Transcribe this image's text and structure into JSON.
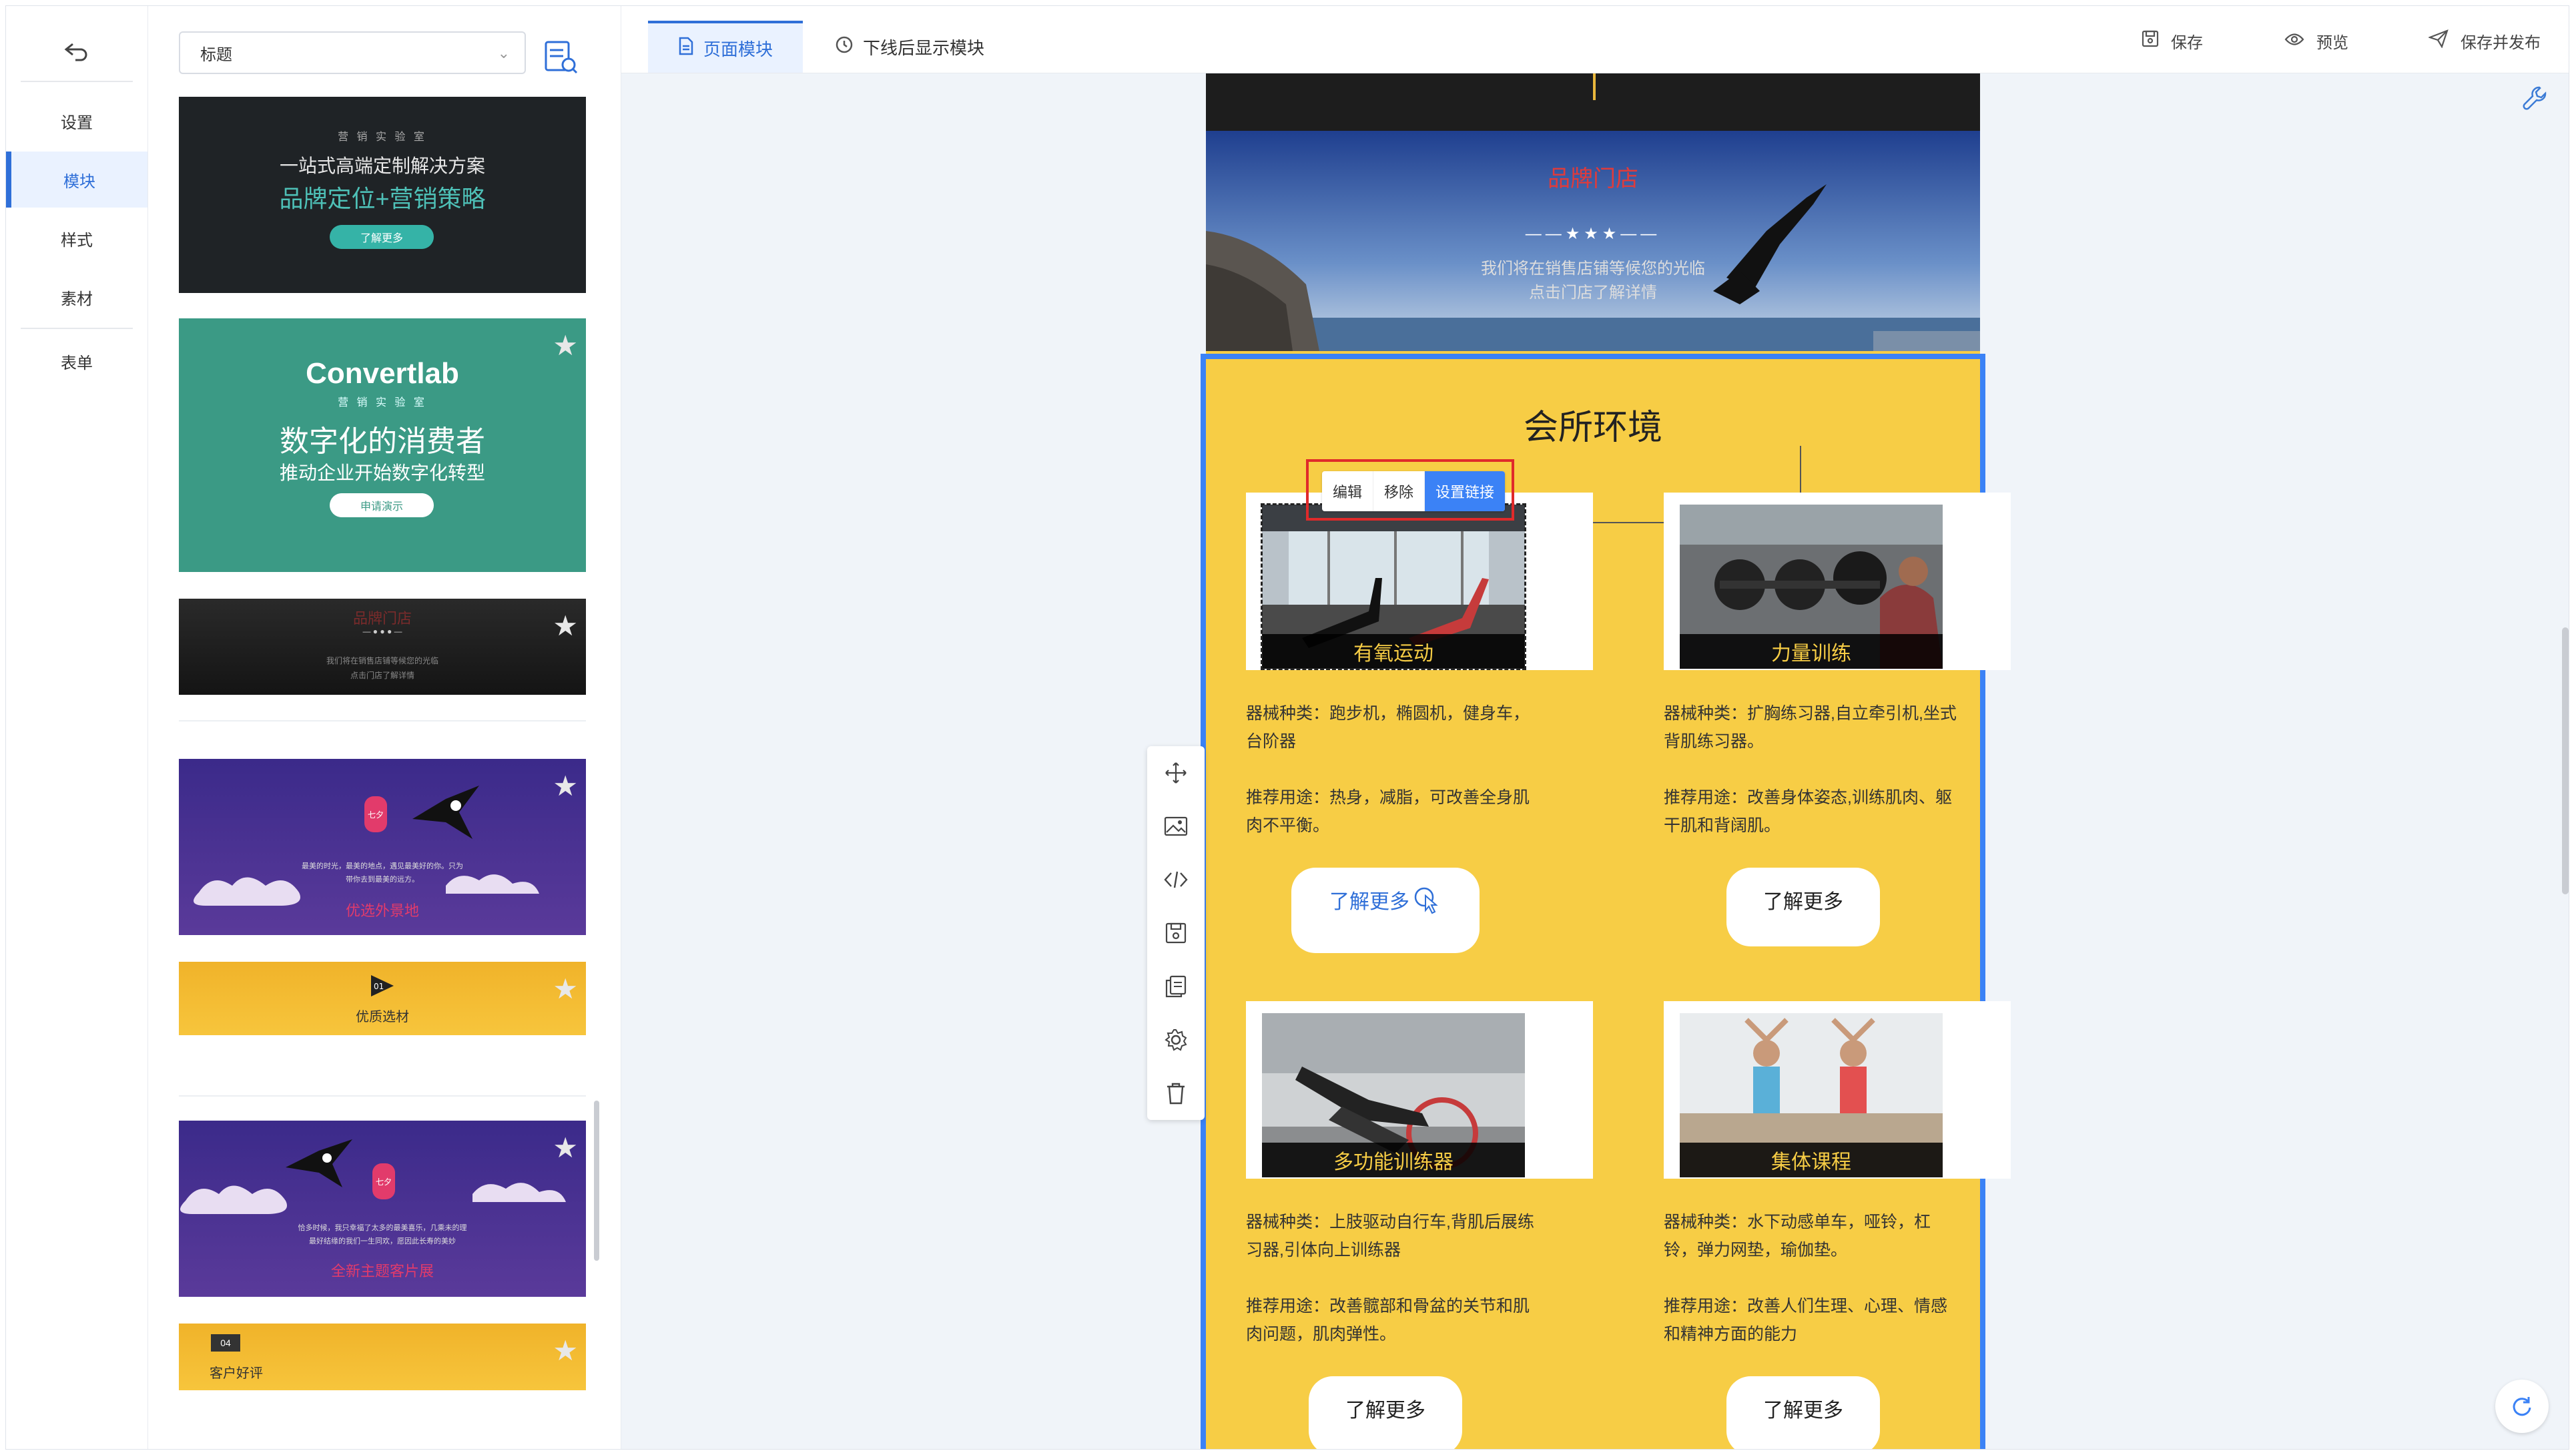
{
  "nav": {
    "back_icon": "back-arrow-icon",
    "items": [
      {
        "label": "设置",
        "active": false
      },
      {
        "label": "模块",
        "active": true
      },
      {
        "label": "样式",
        "active": false
      },
      {
        "label": "素材",
        "active": false
      },
      {
        "label": "表单",
        "active": false
      }
    ]
  },
  "panel": {
    "select_value": "标题",
    "thumbs": [
      {
        "line1": "营 销 实 验 室",
        "line2": "一站式高端定制解决方案",
        "line3": "品牌定位+营销策略",
        "button": "了解更多"
      },
      {
        "brand": "Convertlab",
        "line1": "营 销 实 验 室",
        "line2": "数字化的消费者",
        "line3": "推动企业开始数字化转型",
        "button": "申请演示"
      },
      {
        "title": "品牌门店",
        "sub1": "我们将在销售店铺等候您的光临",
        "sub2": "点击门店了解详情"
      },
      {
        "badge": "七夕",
        "text1": "最美的时光，最美的地点，遇见最美好的你。只为",
        "text2": "带你去到最美的远方。",
        "title": "优选外景地"
      },
      {
        "badge": "01",
        "title": "优质选材"
      },
      {
        "badge": "七夕",
        "text1": "恰多时候，我只幸福了太多的最美喜乐，几乘未的理",
        "text2": "最好结缘的我们一生同欢，愿因此长寿的美妙",
        "title": "全新主题客片展"
      },
      {
        "badge": "04",
        "title": "客户好评"
      }
    ]
  },
  "header": {
    "tabs": [
      {
        "label": "页面模块",
        "active": true
      },
      {
        "label": "下线后显示模块",
        "active": false
      }
    ],
    "actions": [
      {
        "label": "保存",
        "icon": "save-icon"
      },
      {
        "label": "预览",
        "icon": "eye-icon"
      },
      {
        "label": "保存并发布",
        "icon": "send-icon"
      }
    ]
  },
  "page": {
    "banner": {
      "title": "品牌门店",
      "stars": "——★★★——",
      "sub1": "我们将在销售店铺等候您的光临",
      "sub2": "点击门店了解详情"
    },
    "section_title": "会所环境",
    "toolbar": {
      "edit": "编辑",
      "remove": "移除",
      "link": "设置链接"
    },
    "items": [
      {
        "caption": "有氧运动",
        "desc1": "器械种类：跑步机，椭圆机，健身车，台阶器",
        "desc2": "推荐用途：热身，减脂，可改善全身肌肉不平衡。",
        "button": "了解更多"
      },
      {
        "caption": "力量训练",
        "desc1": "器械种类：扩胸练习器,自立牵引机,坐式背肌练习器。",
        "desc2": "推荐用途：改善身体姿态,训练肌肉、躯干肌和背阔肌。",
        "button": "了解更多"
      },
      {
        "caption": "多功能训练器",
        "desc1": "器械种类：上肢驱动自行车,背肌后展练习器,引体向上训练器",
        "desc2": "推荐用途：改善髋部和骨盆的关节和肌肉问题，肌肉弹性。",
        "button": "了解更多"
      },
      {
        "caption": "集体课程",
        "desc1": "器械种类：水下动感单车，哑铃，杠铃，弹力网垫，瑜伽垫。",
        "desc2": "推荐用途：改善人们生理、心理、情感和精神方面的能力",
        "button": "了解更多"
      }
    ]
  },
  "colors": {
    "accent": "#3b82f6",
    "page_bg": "#f7cd45",
    "selection": "#e02a2a"
  }
}
